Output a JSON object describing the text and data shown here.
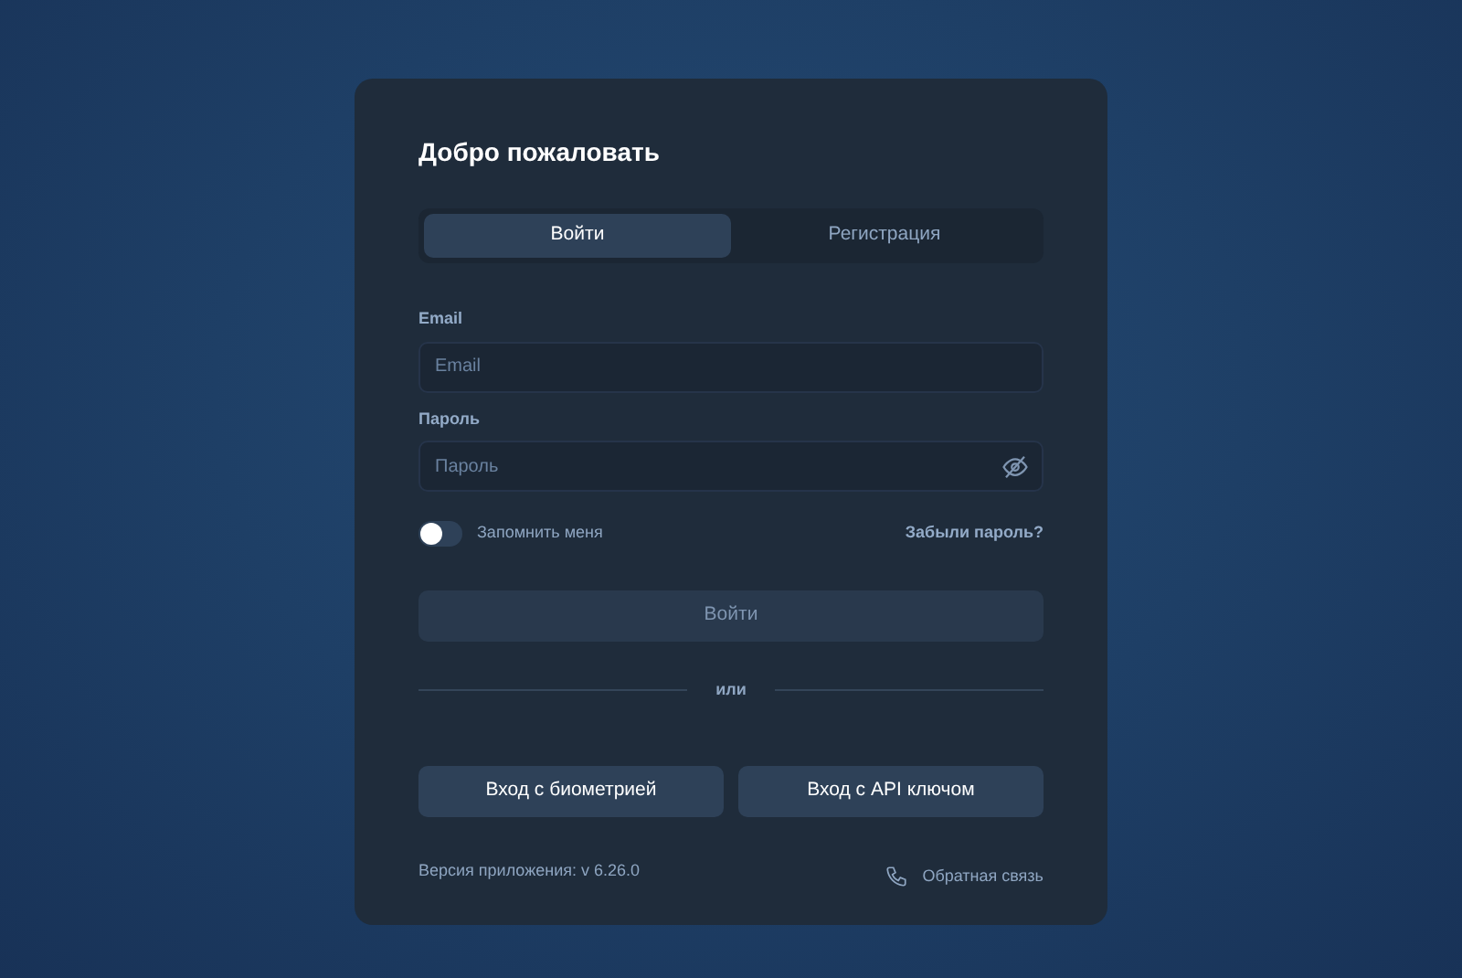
{
  "title": "Добро пожаловать",
  "tabs": [
    {
      "label": "Войти",
      "selected": true
    },
    {
      "label": "Регистрация",
      "selected": false
    }
  ],
  "fields": [
    {
      "kind": "text",
      "label": "Email",
      "placeholder": "Email"
    },
    {
      "kind": "password",
      "label": "Пароль",
      "placeholder": "Пароль"
    }
  ],
  "remember": {
    "label": "Запомнить меня",
    "on": false
  },
  "forgot_link": "Забыли пароль?",
  "submit": {
    "label": "Войти",
    "disabled": true
  },
  "divider": "или",
  "alt_buttons": [
    "Вход с биометрией",
    "Вход с API ключом"
  ],
  "version": "Версия приложения: v 6.26.0",
  "feedback_link": "Обратная связь"
}
